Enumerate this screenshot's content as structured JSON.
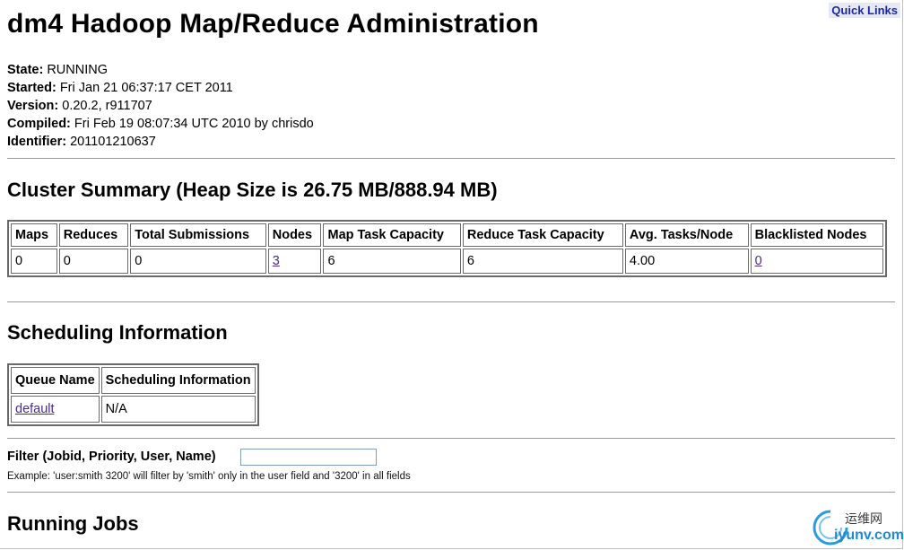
{
  "header": {
    "quick_links": "Quick Links",
    "title": "dm4 Hadoop Map/Reduce Administration"
  },
  "info": [
    {
      "label": "State:",
      "value": "RUNNING"
    },
    {
      "label": "Started:",
      "value": "Fri Jan 21 06:37:17 CET 2011"
    },
    {
      "label": "Version:",
      "value": "0.20.2, r911707"
    },
    {
      "label": "Compiled:",
      "value": "Fri Feb 19 08:07:34 UTC 2010 by chrisdo"
    },
    {
      "label": "Identifier:",
      "value": "201101210637"
    }
  ],
  "cluster_summary": {
    "heading": "Cluster Summary (Heap Size is 26.75 MB/888.94 MB)",
    "headers": [
      "Maps",
      "Reduces",
      "Total Submissions",
      "Nodes",
      "Map Task Capacity",
      "Reduce Task Capacity",
      "Avg. Tasks/Node",
      "Blacklisted Nodes"
    ],
    "values": [
      "0",
      "0",
      "0",
      "3",
      "6",
      "6",
      "4.00",
      "0"
    ]
  },
  "scheduling": {
    "heading": "Scheduling Information",
    "headers": [
      "Queue Name",
      "Scheduling Information"
    ],
    "rows": [
      [
        "default",
        "N/A"
      ]
    ]
  },
  "filter": {
    "label": "Filter (Jobid, Priority, User, Name)",
    "value": "",
    "example": "Example: 'user:smith 3200' will filter by 'smith' only in the user field and '3200' in all fields"
  },
  "running_jobs": {
    "heading": "Running Jobs"
  },
  "watermark": {
    "top": "运维网",
    "bottom": "iyunv.com"
  }
}
